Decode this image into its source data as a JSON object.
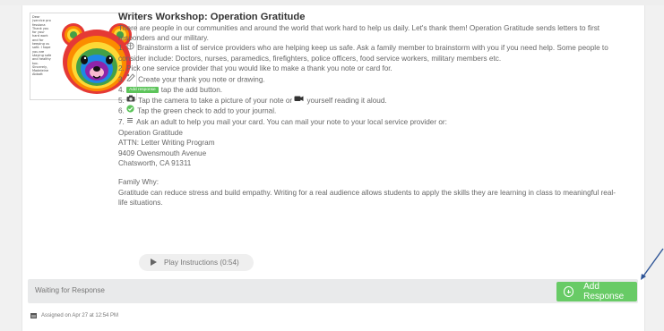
{
  "activity": {
    "title": "Writers Workshop: Operation Gratitude",
    "intro": "There are people in our communities and around the world that work hard to help us daily. Let's thank them! Operation Gratitude sends letters to first responders and our military.",
    "steps": [
      "1. 🧠 Brainstorm a list of service providers who are helping keep us safe. Ask a family member to brainstorm with you if you need help. Some people to consider include: Doctors, nurses, paramedics, firefighters, police officers, food service workers, military members etc.",
      "2. Pick one service provider that you would like to make a thank you note or card for.",
      "3. Create your thank you note or drawing.",
      "4. tap the add button.",
      "5. Tap the camera to take a picture of your note or yourself reading it aloud.",
      "6. Tap the green check to add to your journal.",
      "7. Ask an adult to help you mail your card. You can mail your note to your local service provider or:"
    ],
    "step1_pre": "1.",
    "step1_text": "Brainstorm a list of service providers who are helping keep us safe. Ask a family member to brainstorm with you if you need help. Some people to consider include: Doctors, nurses, paramedics, firefighters, police officers, food service workers, military members etc.",
    "step2": "2. Pick one service provider that you would like to make a thank you note or card for.",
    "step3_pre": "3.",
    "step3_text": "Create your thank you note or drawing.",
    "step4_pre": "4.",
    "step4_badge": "Add response",
    "step4_text": "tap the add button.",
    "step5_pre": "5.",
    "step5_a": "Tap the camera to take a picture of your note or",
    "step5_b": "yourself reading it aloud.",
    "step6_pre": "6.",
    "step6_text": "Tap the green check to add to your journal.",
    "step7_pre": "7.",
    "step7_text": "Ask an adult to help you mail your card. You can mail your note to your local service provider or:",
    "address": [
      "Operation Gratitude",
      "ATTN: Letter Writing Program",
      "9409 Owensmouth Avenue",
      "Chatsworth, CA 91311"
    ],
    "family_why_label": "Family Why:",
    "family_why_text": "Gratitude can reduce stress and build empathy. Writing for a real audience allows students to apply the skills they are learning in class to meaningful real-life situations.",
    "play_label": "Play Instructions (0:54)"
  },
  "thumbnail_text": [
    "Dear",
    "(service pro",
    "fessiona",
    "Thank you",
    "for your",
    "hard work",
    "and for",
    "keeping us",
    "safe. I hope",
    "you are",
    "staying safe",
    "and healthy",
    "too.",
    "Sincerely,",
    "Madeleine",
    "Abbott"
  ],
  "status": {
    "text": "Waiting for Response",
    "add_response_label": "Add Response"
  },
  "assigned": {
    "text": "Assigned on Apr 27 at 12:54 PM"
  },
  "colors": {
    "accent_green": "#68cb66",
    "status_bg": "#e9eaeb",
    "arrow_blue": "#2f5597"
  }
}
